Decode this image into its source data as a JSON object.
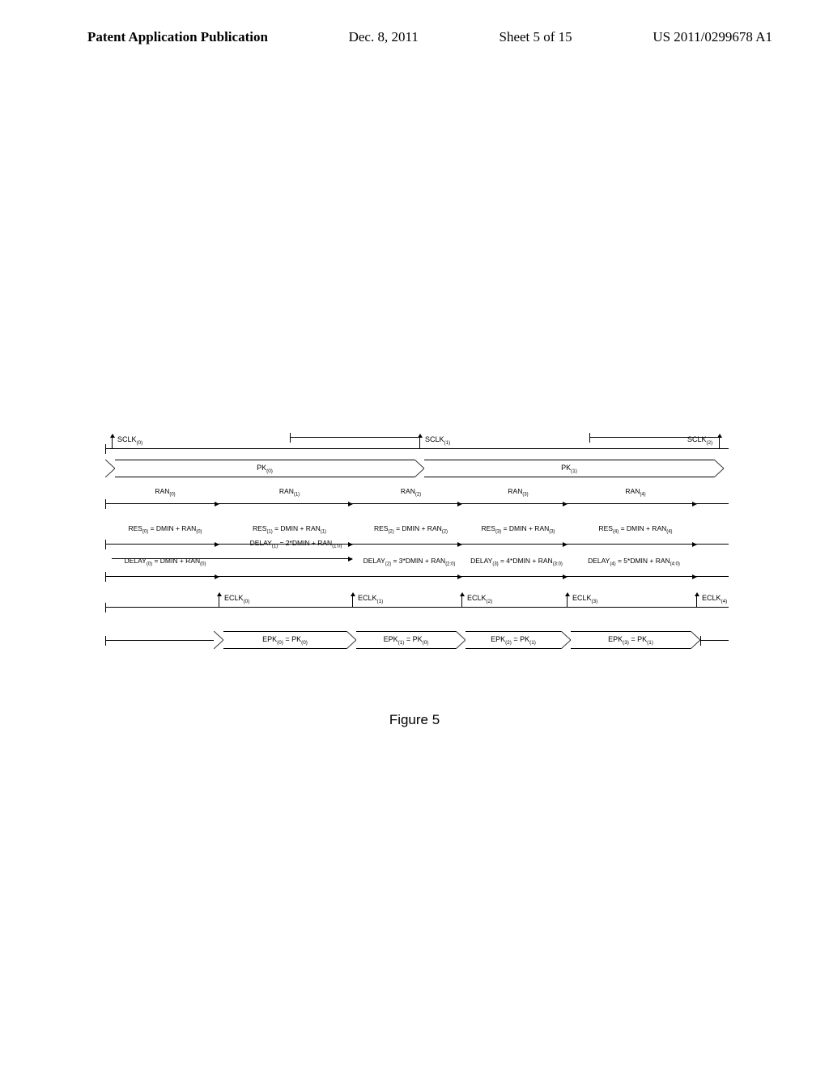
{
  "header": {
    "title": "Patent Application Publication",
    "date": "Dec. 8, 2011",
    "sheet": "Sheet 5 of 15",
    "pubno": "US 2011/0299678 A1"
  },
  "figure_caption": "Figure 5",
  "chart_data": {
    "type": "timing-diagram",
    "rows": [
      {
        "name": "SCLK",
        "ticks": [
          "SCLK(0)",
          "SCLK(1)",
          "SCLK(2)"
        ]
      },
      {
        "name": "PK",
        "segments": [
          "PK(0)",
          "PK(1)"
        ]
      },
      {
        "name": "RAN",
        "spans": [
          "RAN(0)",
          "RAN(1)",
          "RAN(2)",
          "RAN(3)",
          "RAN(4)"
        ]
      },
      {
        "name": "RES",
        "spans": [
          "RES(0) = DMIN + RAN(0)",
          "RES(1) = DMIN + RAN(1)",
          "RES(2) = DMIN + RAN(2)",
          "RES(3) = DMIN + RAN(3)",
          "RES(4) = DMIN + RAN(4)"
        ]
      },
      {
        "name": "DELAY",
        "spans": [
          "DELAY(0) = DMIN + RAN(0)",
          "DELAY(1) = 2*DMIN + RAN(1:0)",
          "DELAY(2) = 3*DMIN + RAN(2:0)",
          "DELAY(3) = 4*DMIN + RAN(3:0)",
          "DELAY(4) = 5*DMIN + RAN(4:0)"
        ]
      },
      {
        "name": "ECLK",
        "ticks": [
          "ECLK(0)",
          "ECLK(1)",
          "ECLK(2)",
          "ECLK(3)",
          "ECLK(4)"
        ]
      },
      {
        "name": "EPK",
        "segments": [
          "EPK(0) = PK(0)",
          "EPK(1) = PK(0)",
          "EPK(2) = PK(1)",
          "EPK(3) = PK(1)"
        ]
      }
    ]
  }
}
